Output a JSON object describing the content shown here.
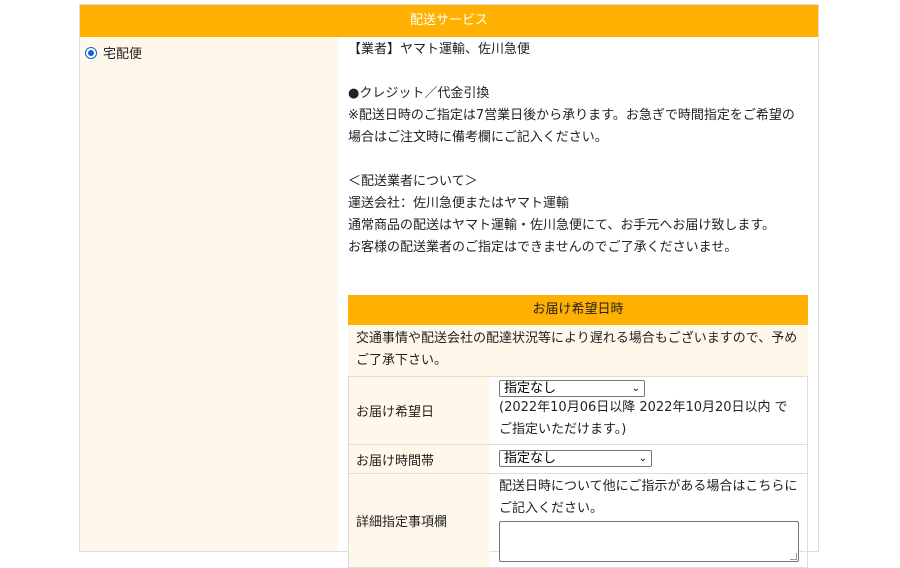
{
  "section_title": "配送サービス",
  "option": {
    "label": "宅配便",
    "selected": true
  },
  "info_lines": [
    "【業者】ヤマト運輸、佐川急便",
    "",
    "●クレジット／代金引換",
    "※配送日時のご指定は7営業日後から承ります。お急ぎで時間指定をご希望の",
    "場合はご注文時に備考欄にご記入ください。",
    "",
    "＜配送業者について＞",
    "運送会社：佐川急便またはヤマト運輸",
    "通常商品の配送はヤマト運輸・佐川急便にて、お手元へお届け致します。",
    "お客様の配送業者のご指定はできませんのでご了承くださいませ。"
  ],
  "delivery": {
    "title": "お届け希望日時",
    "notice_line1": "交通事情や配送会社の配達状況等により遅れる場合もございますので、予め",
    "notice_line2": "ご了承下さい。",
    "date_label": "お届け希望日",
    "date_selected": "指定なし",
    "date_note_line1": "(2022年10月06日以降 2022年10月20日以内 で",
    "date_note_line2": "ご指定いただけます。)",
    "time_label": "お届け時間帯",
    "time_selected": "指定なし",
    "detail_label": "詳細指定事項欄",
    "detail_note_line1": "配送日時について他にご指示がある場合はこちらに",
    "detail_note_line2": "ご記入ください。",
    "detail_value": ""
  },
  "colors": {
    "accent": "#ffb000",
    "panel": "#fff7ea",
    "radio": "#0b63d6"
  }
}
